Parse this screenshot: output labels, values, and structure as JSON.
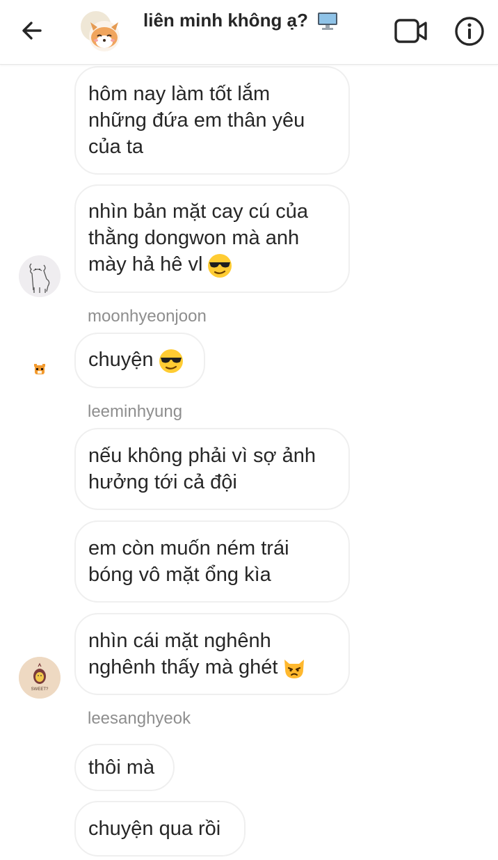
{
  "header": {
    "title": "liên minh không ạ?",
    "title_emoji_icon": "desktop-computer-icon",
    "back_icon": "arrow-left-icon",
    "video_icon": "video-camera-icon",
    "info_icon": "info-circle-icon",
    "group_avatar_icon": "shiba-dog-avatar-icon"
  },
  "messages": [
    {
      "text": "hôm nay làm tốt lắm\nnhững đứa em thân yêu\ncủa ta",
      "emoji": null
    },
    {
      "text": "nhìn bản mặt cay cú của\nthằng dongwon mà anh\nmày hả hê vl",
      "emoji": "sunglasses-face-icon"
    },
    {
      "sender": "moonhyeonjoon"
    },
    {
      "text": "chuyện",
      "emoji": "sunglasses-face-icon"
    },
    {
      "sender": "leeminhyung"
    },
    {
      "text": "nếu không phải vì sợ ảnh\nhưởng tới cả đội",
      "emoji": null
    },
    {
      "text": "em còn muốn ném trái\nbóng vô mặt ổng kìa",
      "emoji": null
    },
    {
      "text": "nhìn cái mặt nghênh\nnghênh thấy mà ghét",
      "emoji": "pouting-cat-icon"
    },
    {
      "sender": "leesanghyeok"
    },
    {
      "text": "thôi mà",
      "emoji": null
    },
    {
      "text": "chuyện qua rồi",
      "emoji": null
    }
  ],
  "avatars": {
    "alpaca": "alpaca-avatar-icon",
    "tiger": "tiger-avatar-icon",
    "sweet_potato": "sweet-potato-avatar-icon",
    "sweet_potato_label": "SWEET?"
  },
  "colors": {
    "bubble_border": "#efefef",
    "sender_name": "#8e8e8e",
    "text": "#262626"
  }
}
